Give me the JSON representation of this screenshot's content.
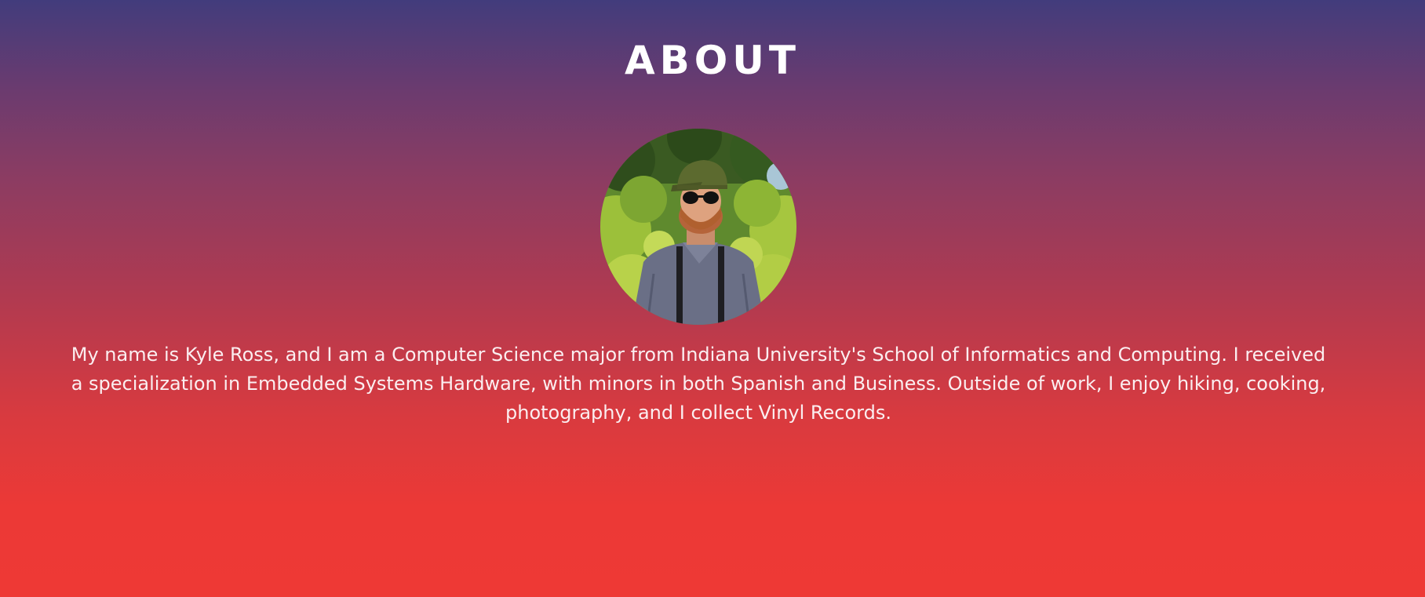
{
  "about": {
    "title": "ABOUT",
    "portrait_icon": "person-photo",
    "bio": "My name is Kyle Ross, and I am a Computer Science major from Indiana University's School of Informatics and Computing. I received a specialization in Embedded Systems Hardware, with minors in both Spanish and Business. Outside of work, I enjoy hiking, cooking, photography, and I collect Vinyl Records."
  },
  "colors": {
    "gradient_top": "#423c7c",
    "gradient_middle": "#b13a50",
    "gradient_bottom": "#ee3935",
    "text": "#ffffff"
  }
}
